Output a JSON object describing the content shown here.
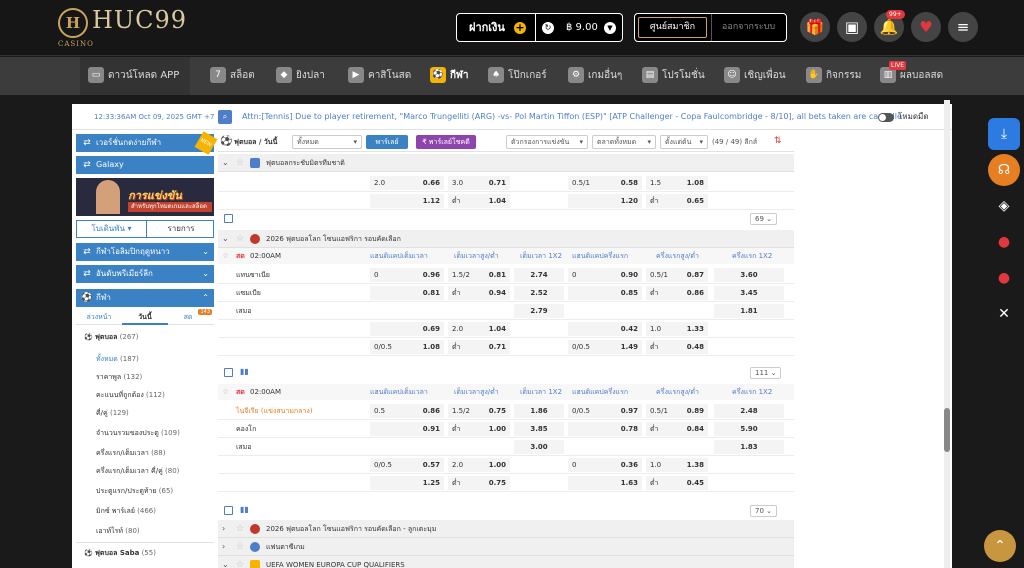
{
  "header": {
    "logo_name": "HUC99",
    "logo_sub": "CASINO",
    "deposit_label": "ฝากเงิน",
    "balance": "฿ 9.00",
    "member_label": "ศูนย์สมาชิก",
    "logout_label": "ออกจากระบบ",
    "notif_badge": "99+"
  },
  "nav": {
    "download": "ดาวน์โหลด APP",
    "items": [
      "สล็อต",
      "ยิงปลา",
      "คาสิโนสด",
      "กีฬา",
      "โป๊กเกอร์",
      "เกมอื่นๆ",
      "โปรโมชั่น",
      "เชิญเพื่อน",
      "กิจกรรม",
      "ผลบอลสด"
    ],
    "live_tag": "LIVE"
  },
  "ticker": {
    "time": "12:33:36AM Oct 09, 2025 GMT +7",
    "message": "Attn:[Tennis] Due to player retirement, \"Marco Trungelliti (ARG) -vs- Pol Martin Tiffon (ESP)\" [ATP Challenger - Copa Faulcombridge - 8/10], all bets taken are cancelled",
    "night_mode": "โหมดมืด"
  },
  "sidebar": {
    "btn1": "เวอร์ชั่นกดง่ายกีฬา",
    "btn2": "Galaxy",
    "banner_text": "การแข่งขัน",
    "banner_sub": "สำหรับทุกโหมดเกมและสล็อต",
    "tab_menu": "โบเดินพัน",
    "tab_list": "รายการ",
    "btn3": "กีฬาโอลิมปิกฤดูหนาว",
    "btn4": "อันดับพรีเมียร์ลีก",
    "btn5": "กีฬา",
    "sub_tabs": [
      "ล่วงหน้า",
      "วันนี้",
      "สด"
    ],
    "live_count": "143",
    "football": "ฟุตบอล",
    "football_count": "(267)",
    "list": [
      {
        "label": "ทั้งหมด",
        "count": "(187)"
      },
      {
        "label": "ราคาพูล",
        "count": "(132)"
      },
      {
        "label": "คะแนนที่ถูกต้อง",
        "count": "(112)"
      },
      {
        "label": "คี่/คู่",
        "count": "(129)"
      },
      {
        "label": "จำนวนรวมของประตู",
        "count": "(109)"
      },
      {
        "label": "ครึ่งแรก/เต็มเวลา",
        "count": "(88)"
      },
      {
        "label": "ครึ่งแรก/เต็มเวลา คี่/คู่",
        "count": "(80)"
      },
      {
        "label": "ประตูแรก/ประตูท้าย",
        "count": "(65)"
      },
      {
        "label": "มิกซ์ พาร์เลย์",
        "count": "(466)"
      },
      {
        "label": "เอาท์ไรท์",
        "count": "(80)"
      }
    ],
    "football_saba": "ฟุตบอล Saba",
    "football_saba_count": "(55)"
  },
  "content": {
    "sport_label": "ฟุตบอล / วันนี้",
    "filter_all": "ทั้งหมด",
    "parlay": "พาร์เลย์",
    "parlay_hot": "พาร์เลย์โชคดี",
    "filter_league": "ตัวกรองการแข่งขัน",
    "market_sort": "ตลาดทั้งหมด",
    "sort_time": "ตั้งแต่ต้น",
    "league_count": "(49 / 49) ลีกส์",
    "top_section": "ฟุตบอลกระชับมิตรทีมชาติ",
    "col_headers": [
      "แฮนดิแคปเต็มเวลา",
      "เต็มเวลาสูง/ต่ำ",
      "เต็มเวลา 1X2",
      "แฮนดิแคปครึ่งแรก",
      "ครึ่งแรกสูง/ต่ำ",
      "ครึ่งแรก 1X2"
    ],
    "top_rows": [
      {
        "hdp": "2.0",
        "hdpo": "0.66",
        "ou": "3.0",
        "ouo": "0.71",
        "x12": "",
        "hhdp": "0.5/1",
        "hhdpo": "0.58",
        "hou": "1.5",
        "houo": "1.08",
        "hx12": ""
      },
      {
        "hdp": "",
        "hdpo": "1.12",
        "ou": "ต่ำ",
        "ouo": "1.04",
        "x12": "",
        "hhdp": "",
        "hhdpo": "1.20",
        "hou": "ต่ำ",
        "houo": "0.65",
        "hx12": ""
      }
    ],
    "more1": "69",
    "section2": "2026 ฟุตบอลโลก โซนแอฟริกา รอบคัดเลือก",
    "live_label": "สด",
    "time1": "02:00AM",
    "match1_rows": [
      {
        "team": "แทนซาเนีย",
        "hdp": "0",
        "hdpo": "0.96",
        "ou": "1.5/2",
        "ouo": "0.81",
        "x12": "2.74",
        "hhdp": "0",
        "hhdpo": "0.90",
        "hou": "0.5/1",
        "houo": "0.87",
        "hx12": "3.60"
      },
      {
        "team": "แซมเบีย",
        "hdp": "",
        "hdpo": "0.81",
        "ou": "ต่ำ",
        "ouo": "0.94",
        "x12": "2.52",
        "hhdp": "",
        "hhdpo": "0.85",
        "hou": "ต่ำ",
        "houo": "0.86",
        "hx12": "3.45"
      },
      {
        "team": "เสมอ",
        "hdp": "",
        "hdpo": "",
        "ou": "",
        "ouo": "",
        "x12": "2.79",
        "hhdp": "",
        "hhdpo": "",
        "hou": "",
        "houo": "",
        "hx12": "1.81"
      },
      {
        "team": "",
        "hdp": "",
        "hdpo": "0.69",
        "ou": "2.0",
        "ouo": "1.04",
        "x12": "",
        "hhdp": "",
        "hhdpo": "0.42",
        "hou": "1.0",
        "houo": "1.33",
        "hx12": ""
      },
      {
        "team": "",
        "hdp": "0/0.5",
        "hdpo": "1.08",
        "ou": "ต่ำ",
        "ouo": "0.71",
        "x12": "",
        "hhdp": "0/0.5",
        "hhdpo": "1.49",
        "hou": "ต่ำ",
        "houo": "0.48",
        "hx12": ""
      }
    ],
    "more2": "111",
    "time2": "02:00AM",
    "match2_rows": [
      {
        "team": "ไนจีเรีย (แข่งสนามกลาง)",
        "hdp": "0.5",
        "hdpo": "0.86",
        "ou": "1.5/2",
        "ouo": "0.75",
        "x12": "1.86",
        "hhdp": "0/0.5",
        "hhdpo": "0.97",
        "hou": "0.5/1",
        "houo": "0.89",
        "hx12": "2.48"
      },
      {
        "team": "คองโก",
        "hdp": "",
        "hdpo": "0.91",
        "ou": "ต่ำ",
        "ouo": "1.00",
        "x12": "3.85",
        "hhdp": "",
        "hhdpo": "0.78",
        "hou": "ต่ำ",
        "houo": "0.84",
        "hx12": "5.90"
      },
      {
        "team": "เสมอ",
        "hdp": "",
        "hdpo": "",
        "ou": "",
        "ouo": "",
        "x12": "3.00",
        "hhdp": "",
        "hhdpo": "",
        "hou": "",
        "houo": "",
        "hx12": "1.83"
      },
      {
        "team": "",
        "hdp": "0/0.5",
        "hdpo": "0.57",
        "ou": "2.0",
        "ouo": "1.00",
        "x12": "",
        "hhdp": "0",
        "hhdpo": "0.36",
        "hou": "1.0",
        "houo": "1.38",
        "hx12": ""
      },
      {
        "team": "",
        "hdp": "",
        "hdpo": "1.25",
        "ou": "ต่ำ",
        "ouo": "0.75",
        "x12": "",
        "hhdp": "",
        "hhdpo": "1.63",
        "hou": "ต่ำ",
        "houo": "0.45",
        "hx12": ""
      }
    ],
    "more3": "70",
    "section3": "2026 ฟุตบอลโลก โซนแอฟริกา รอบคัดเลือก - ลูกเตะมุม",
    "section4": "แฟนตาซีเกม",
    "section5": "UEFA WOMEN EUROPA CUP QUALIFIERS"
  }
}
